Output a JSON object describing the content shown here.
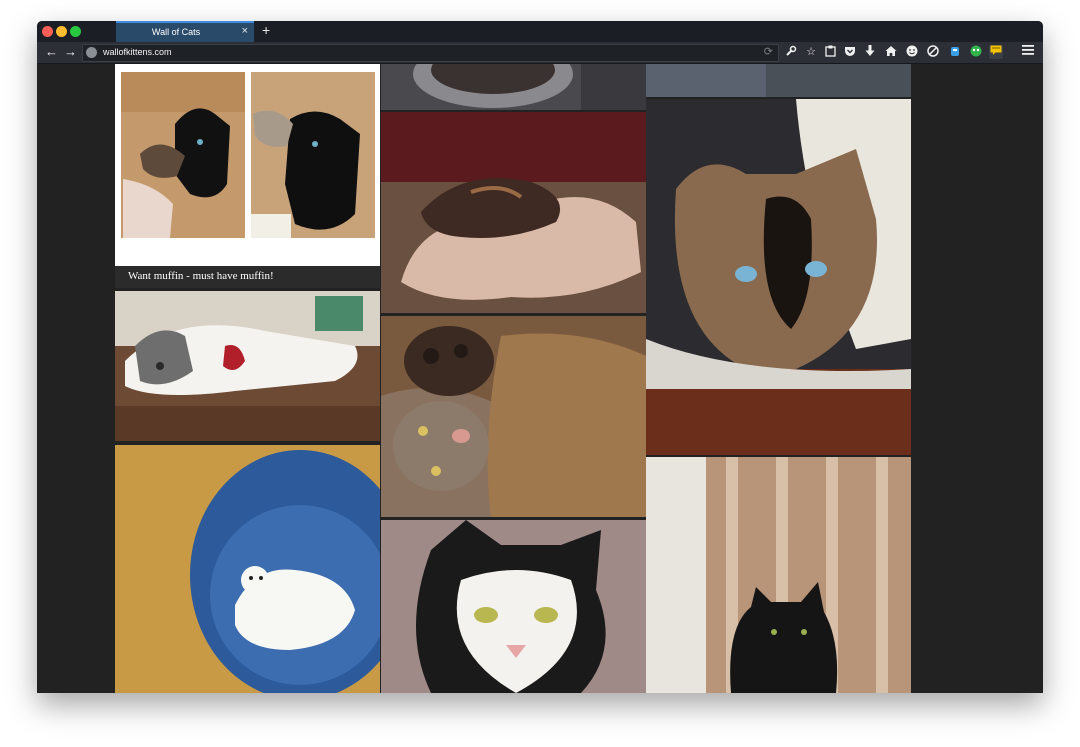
{
  "browser": {
    "tab_title": "Wall of Cats",
    "tab_close": "×",
    "new_tab": "+",
    "url": "wallofkittens.com",
    "back": "←",
    "forward": "→",
    "reload": "⟳",
    "toolbar_icons": [
      "wrench-icon",
      "star-icon",
      "clipboard-icon",
      "pocket-icon",
      "download-icon",
      "home-icon",
      "emoji-icon",
      "no-sign-icon",
      "extension-icon",
      "ghostery-icon",
      "note-icon",
      "menu-icon"
    ]
  },
  "wall": {
    "caption": "Want muffin - must have muffin!"
  },
  "colors": {
    "tab_active": "#2a4a6a",
    "tab_accent": "#3d8ee0",
    "background": "#222222"
  }
}
